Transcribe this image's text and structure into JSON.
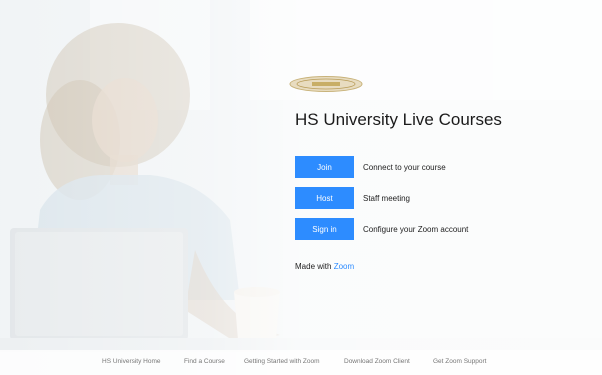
{
  "page": {
    "title": "HS University Live Courses"
  },
  "actions": [
    {
      "button_label": "Join",
      "description": "Connect to your course"
    },
    {
      "button_label": "Host",
      "description": "Staff meeting"
    },
    {
      "button_label": "Sign in",
      "description": "Configure your Zoom account"
    }
  ],
  "made_with": {
    "prefix": "Made with",
    "link": "Zoom"
  },
  "footer": {
    "links": [
      "HS University Home",
      "Find a Course",
      "Getting Started with Zoom",
      "Download Zoom Client",
      "Get Zoom Support"
    ]
  },
  "colors": {
    "accent": "#2d8cff",
    "text": "#1b1b1b",
    "footer_text": "#777777"
  },
  "icons": {
    "logo": "hs-university-seal-logo"
  }
}
